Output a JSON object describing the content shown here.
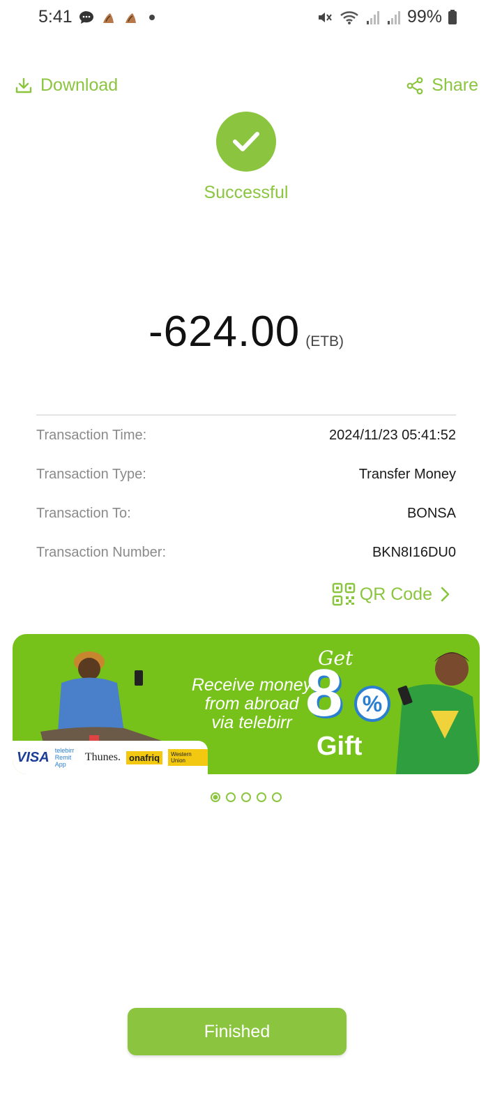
{
  "status_bar": {
    "time": "5:41",
    "battery": "99%",
    "icons": [
      "message-icon",
      "app-notification-icon",
      "app-notification-icon",
      "dot-icon",
      "mute-icon",
      "wifi-icon",
      "signal-icon",
      "signal-icon",
      "battery-icon"
    ]
  },
  "header": {
    "download_label": "Download",
    "share_label": "Share"
  },
  "status": {
    "label": "Successful"
  },
  "amount": {
    "value": "-624.00",
    "currency": "(ETB)"
  },
  "details": [
    {
      "label": "Transaction Time:",
      "value": "2024/11/23 05:41:52"
    },
    {
      "label": "Transaction Type:",
      "value": "Transfer Money"
    },
    {
      "label": "Transaction To:",
      "value": "BONSA"
    },
    {
      "label": "Transaction Number:",
      "value": "BKN8I16DU0"
    }
  ],
  "qr": {
    "label": "QR Code"
  },
  "banner": {
    "text_line1": "Receive money",
    "text_line2": "from abroad",
    "text_line3": "via telebirr",
    "get": "Get",
    "digit": "8",
    "percent": "%",
    "gift": "Gift",
    "partners": {
      "visa": "VISA",
      "remit": "telebirr Remit App",
      "thunes": "Thunes.",
      "onafriq": "onafriq",
      "wu": "Western Union"
    }
  },
  "carousel": {
    "count": 5,
    "active": 0
  },
  "footer": {
    "finish_label": "Finished"
  },
  "colors": {
    "accent": "#8bc53f",
    "banner": "#76c21a"
  }
}
